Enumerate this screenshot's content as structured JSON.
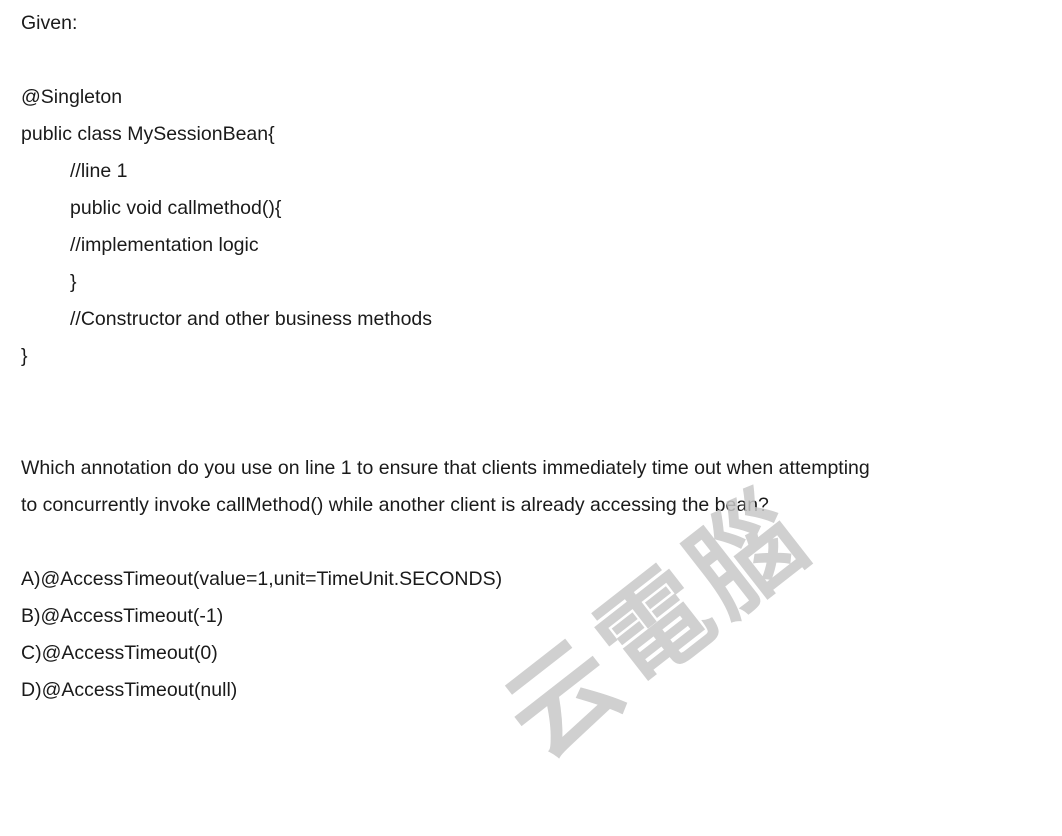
{
  "given_label": "Given:",
  "code": {
    "annotation": "@Singleton",
    "class_decl": "public class MySessionBean{",
    "line1_comment": "//line 1",
    "method_decl": "public void callmethod(){",
    "impl_comment": "//implementation logic",
    "method_close": "}",
    "ctor_comment": "//Constructor and other business methods",
    "class_close": "}"
  },
  "question": {
    "line1": "Which annotation do you use on line 1 to ensure that clients immediately time out when attempting",
    "line2": "to concurrently invoke callMethod() while another client is already accessing the bean?"
  },
  "options": [
    "A)@AccessTimeout(value=1,unit=TimeUnit.SECONDS)",
    "B)@AccessTimeout(-1)",
    "C)@AccessTimeout(0)",
    "D)@AccessTimeout(null)"
  ],
  "watermark": "云電腦"
}
